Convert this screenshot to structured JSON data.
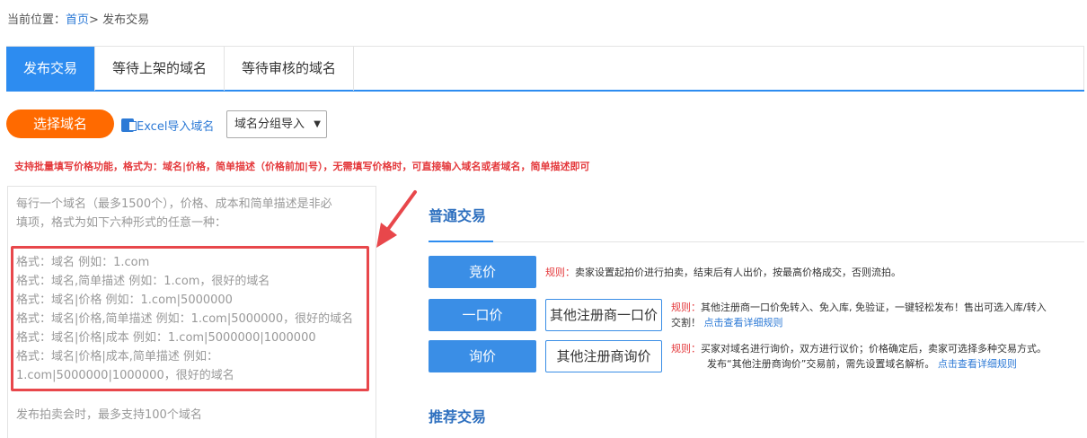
{
  "breadcrumb": {
    "prefix": "当前位置：",
    "home": "首页",
    "sep": ">",
    "current": "发布交易"
  },
  "tabs": [
    {
      "label": "发布交易"
    },
    {
      "label": "等待上架的域名"
    },
    {
      "label": "等待审核的域名"
    }
  ],
  "toolbar": {
    "select_domain": "选择域名",
    "excel_import": "Excel导入域名",
    "group_import": "域名分组导入",
    "group_arrow": "▼"
  },
  "tip": "支持批量填写价格功能，格式为：域名|价格，简单描述（价格前加|号），无需填写价格时，可直接输入域名或者域名，简单描述即可",
  "textarea": {
    "intro_1": "每行一个域名（最多1500个），价格、成本和简单描述是非必",
    "intro_2": "填项，格式为如下六种形式的任意一种：",
    "formats": [
      "格式：域名 例如：1.com",
      "格式：域名,简单描述 例如：1.com，很好的域名",
      "格式：域名|价格 例如：1.com|5000000",
      "格式：域名|价格,简单描述 例如：1.com|5000000，很好的域名",
      "格式：域名|价格|成本 例如：1.com|5000000|1000000",
      "格式：域名|价格|成本,简单描述 例如：",
      "1.com|5000000|1000000，很好的域名"
    ],
    "auction_note": "发布拍卖会时，最多支持100个域名"
  },
  "normal": {
    "title": "普通交易",
    "auction": {
      "label": "竞价",
      "rule_label": "规则：",
      "rule": "卖家设置起拍价进行拍卖，结束后有人出价，按最高价格成交，否则流拍。"
    },
    "fixed": {
      "label": "一口价",
      "other_label": "其他注册商一口价",
      "rule_label": "规则：",
      "rule_1": "其他注册商一口价免转入、免入库, 免验证，一键轻松发布！售出可选入库/转入",
      "rule_2": "交割！",
      "link": "点击查看详细规则"
    },
    "inquiry": {
      "label": "询价",
      "other_label": "其他注册商询价",
      "rule_label": "规则：",
      "rule_1": "买家对域名进行询价，双方进行议价；价格确定后，卖家可选择多种交易方式。",
      "rule_2": "发布“其他注册商询价”交易前，需先设置域名解析。",
      "link": "点击查看详细规则"
    }
  },
  "recommend": {
    "title": "推荐交易"
  },
  "colors": {
    "primary": "#2d8cf0",
    "orange": "#ff6a00",
    "red": "#e4393c",
    "box_red": "#e8474b"
  }
}
